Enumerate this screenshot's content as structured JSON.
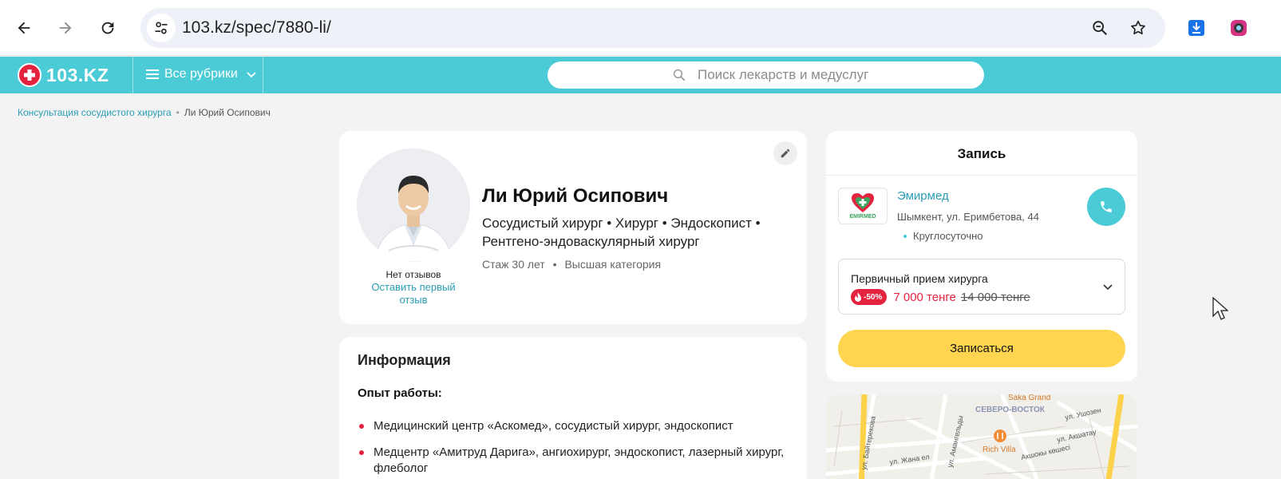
{
  "browser": {
    "url": "103.kz/spec/7880-li/"
  },
  "site": {
    "logo_text": "103.KZ",
    "rubrics_label": "Все рубрики",
    "search_placeholder": "Поиск лекарств и медуслуг",
    "brand_color": "#4bcbd6",
    "accent_color": "#e4233f"
  },
  "breadcrumb": {
    "parent": "Консультация сосудистого хирурга",
    "separator": "•",
    "current": "Ли Юрий Осипович"
  },
  "profile": {
    "name": "Ли Юрий Осипович",
    "specialties": "Сосудистый хирург • Хирург • Эндоскопист • Рентгено-эндоваскулярный хирург",
    "experience": "Стаж 30 лет",
    "meta_separator": "•",
    "category": "Высшая категория",
    "no_reviews": "Нет отзывов",
    "leave_review": "Оставить первый отзыв"
  },
  "info": {
    "title": "Информация",
    "work_experience_label": "Опыт работы:",
    "items": [
      "Медицинский центр «Аскомед», сосудистый хирург, эндоскопист",
      "Медцентр «Амитруд Дарига», ангиохирург, эндоскопист, лазерный хирург, флеболог"
    ]
  },
  "booking": {
    "title": "Запись",
    "clinic": {
      "logo_text": "EMIRMED",
      "name": "Эмирмед",
      "address": "Шымкент, ул. Еримбетова, 44",
      "hours": "Круглосуточно"
    },
    "service": {
      "name": "Первичный прием хирурга",
      "discount": "-50%",
      "price_new": "7 000 тенге",
      "price_old": "14 000 тенге"
    },
    "book_button": "Записаться"
  },
  "map": {
    "labels": {
      "district": "СЕВЕРО-ВОСТОК",
      "place1": "Saka Grand",
      "place2": "Rich Villa",
      "street1": "ул. Байтерекова",
      "street2": "ул. Жана ел",
      "street3": "ул. Амангельды",
      "street4": "ул. Акшатау",
      "street5": "Акшокы көшесі",
      "street6": "ул. Ушозен"
    }
  }
}
